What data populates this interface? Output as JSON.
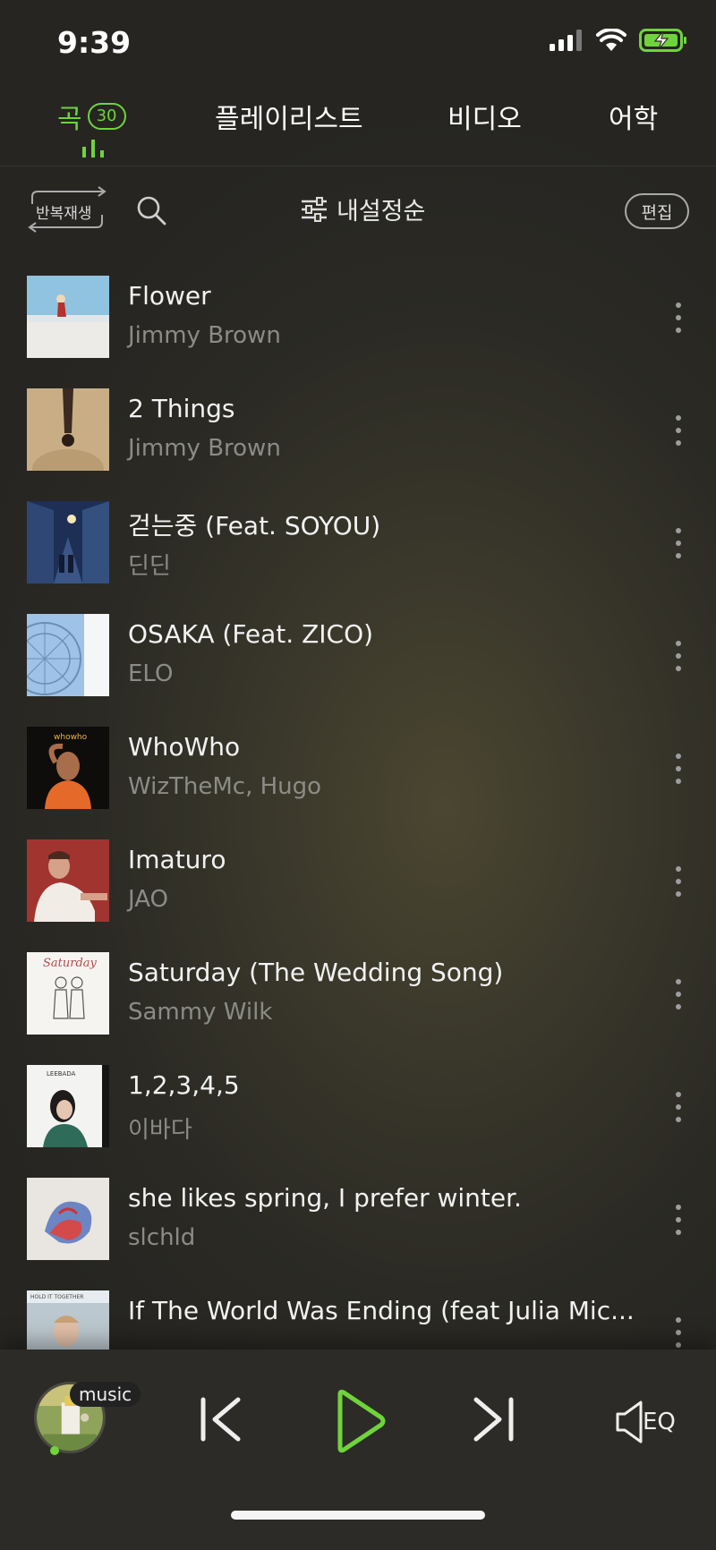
{
  "status_bar": {
    "time": "9:39"
  },
  "tabs": {
    "songs": {
      "label": "곡",
      "count": "30"
    },
    "playlist": "플레이리스트",
    "video": "비디오",
    "language": "어학"
  },
  "toolbar": {
    "repeat_label": "반복재생",
    "sort_label": "내설정순",
    "edit_label": "편집"
  },
  "songs": [
    {
      "title": "Flower",
      "artist": "Jimmy Brown"
    },
    {
      "title": "2 Things",
      "artist": "Jimmy Brown"
    },
    {
      "title": "걷는중 (Feat. SOYOU)",
      "artist": "딘딘"
    },
    {
      "title": "OSAKA (Feat. ZICO)",
      "artist": "ELO"
    },
    {
      "title": "WhoWho",
      "artist": "WizTheMc, Hugo"
    },
    {
      "title": "Imaturo",
      "artist": "JAO"
    },
    {
      "title": "Saturday (The Wedding Song)",
      "artist": "Sammy Wilk"
    },
    {
      "title": "1,2,3,4,5",
      "artist": "이바다"
    },
    {
      "title": "she likes spring, I prefer winter.",
      "artist": "slchld"
    },
    {
      "title": "If The World Was Ending (feat Julia Mic...",
      "artist": ""
    }
  ],
  "album_art": {
    "whowho_text": "whowho",
    "saturday_text": "Saturday",
    "leebada_text": "LEEBADA",
    "hold_text": "HOLD IT TOGETHER"
  },
  "player": {
    "badge": "music",
    "eq_label": "EQ"
  },
  "colors": {
    "accent": "#6fd43b",
    "secondary_text": "#8c8c86"
  }
}
